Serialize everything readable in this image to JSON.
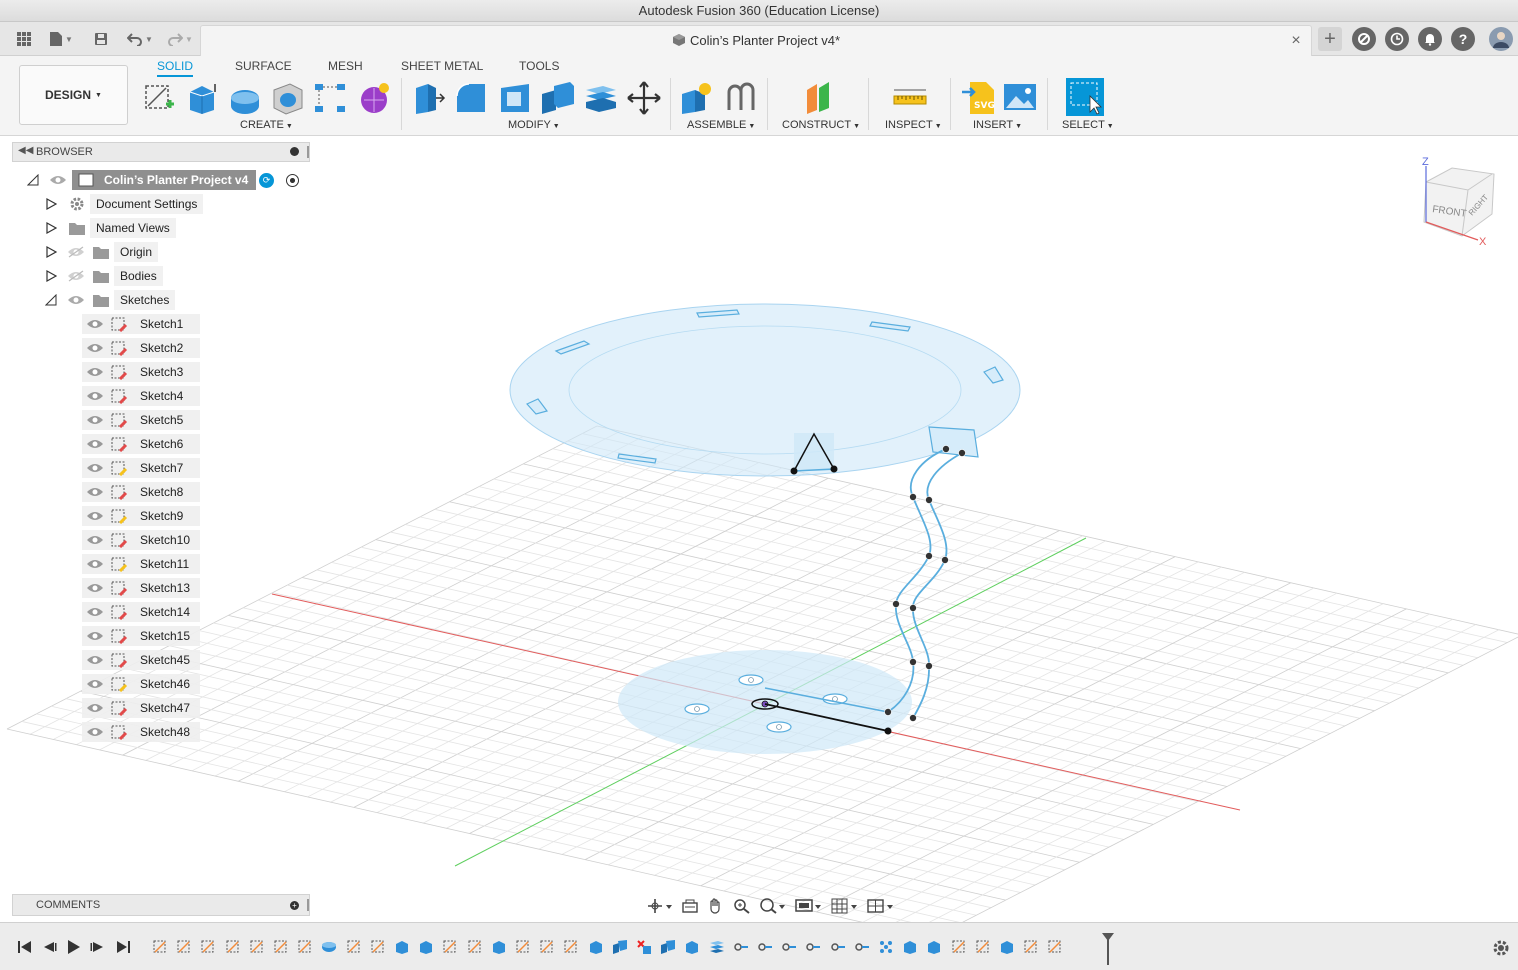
{
  "window": {
    "title": "Autodesk Fusion 360 (Education License)"
  },
  "document_tab": {
    "title": "Colin’s Planter Project v4*",
    "close": "×"
  },
  "workspace": {
    "label": "DESIGN"
  },
  "ribbon": {
    "tabs": [
      {
        "label": "SOLID",
        "active": true
      },
      {
        "label": "SURFACE",
        "active": false
      },
      {
        "label": "MESH",
        "active": false
      },
      {
        "label": "SHEET METAL",
        "active": false
      },
      {
        "label": "TOOLS",
        "active": false
      }
    ],
    "groups": [
      {
        "label": "CREATE"
      },
      {
        "label": "MODIFY"
      },
      {
        "label": "ASSEMBLE"
      },
      {
        "label": "CONSTRUCT"
      },
      {
        "label": "INSPECT"
      },
      {
        "label": "INSERT"
      },
      {
        "label": "SELECT"
      }
    ]
  },
  "browser": {
    "title": "BROWSER",
    "root": "Colin’s Planter Project v4",
    "folders": [
      "Document Settings",
      "Named Views",
      "Origin",
      "Bodies",
      "Sketches"
    ],
    "sketches": [
      "Sketch1",
      "Sketch2",
      "Sketch3",
      "Sketch4",
      "Sketch5",
      "Sketch6",
      "Sketch7",
      "Sketch8",
      "Sketch9",
      "Sketch10",
      "Sketch11",
      "Sketch13",
      "Sketch14",
      "Sketch15",
      "Sketch45",
      "Sketch46",
      "Sketch47",
      "Sketch48"
    ]
  },
  "comments": {
    "title": "COMMENTS"
  },
  "viewcube": {
    "front": "FRONT",
    "right": "RIGHT",
    "axis_z": "Z",
    "axis_x": "X"
  },
  "colors": {
    "accent": "#0696d7",
    "sketch_blue": "#6fb8e0",
    "x_axis": "#e25b5b",
    "y_axis": "#5fcf5f",
    "grid": "#dcdcdc"
  }
}
